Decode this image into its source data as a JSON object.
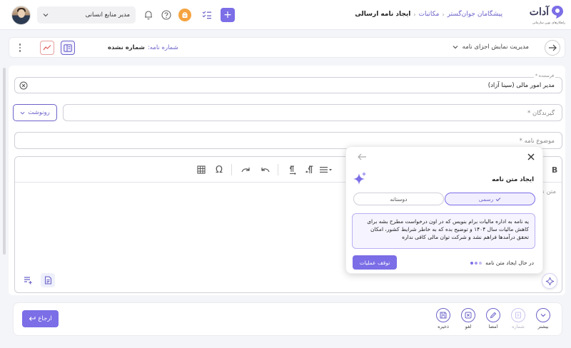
{
  "brand": {
    "name": "آدات",
    "tagline": "راهکارهای نوین سازمانی"
  },
  "breadcrumb": {
    "items": [
      "پیشگامان جوان‌گستر",
      "مکاتبات"
    ],
    "current": "ایجاد نامه ارسالی",
    "separator": "‹"
  },
  "header": {
    "role": "مدیر منابع انسانی",
    "add_label": "+"
  },
  "toolbar": {
    "display_management": "مدیریت نمایش اجزای نامه",
    "letter_number_label": "شماره نامه:",
    "letter_number_value": "شماره نشده"
  },
  "form": {
    "sender_label": "فرستنده *",
    "sender_value": "مدیر امور مالی (سینا آزاد)",
    "recipients_placeholder": "گیرندگان *",
    "cc_label": "رونوشت",
    "subject_placeholder": "موضوع نامه *",
    "body_placeholder": "متن نا",
    "bold_label": "B",
    "omega_label": "Ω"
  },
  "ai_panel": {
    "title": "ایجاد متن نامه",
    "tone_formal": "رسمی",
    "tone_friendly": "دوستانه",
    "prompt_text": "یه نامه به اداره مالیات برام بنویس که در اون درخواست مطرح بشه برای کاهش مالیات سال ۱۴۰۴ و توضیح بده که به خاطر شرایط کشور، امکان تحقق درآمدها فراهم نشد و شرکت توان مالی کافی نداره",
    "status": "در حال ایجاد متن نامه",
    "stop_label": "توقف عملیات"
  },
  "actions": {
    "more": "بیشتر",
    "number": "شماره",
    "sign": "امضا",
    "cancel": "لغو",
    "save": "ذخیره",
    "refer": "ارجاع"
  },
  "colors": {
    "accent": "#7b6ee6",
    "accent_dark": "#6c63c9",
    "store": "#f5a340",
    "chart": "#e05a5a"
  }
}
